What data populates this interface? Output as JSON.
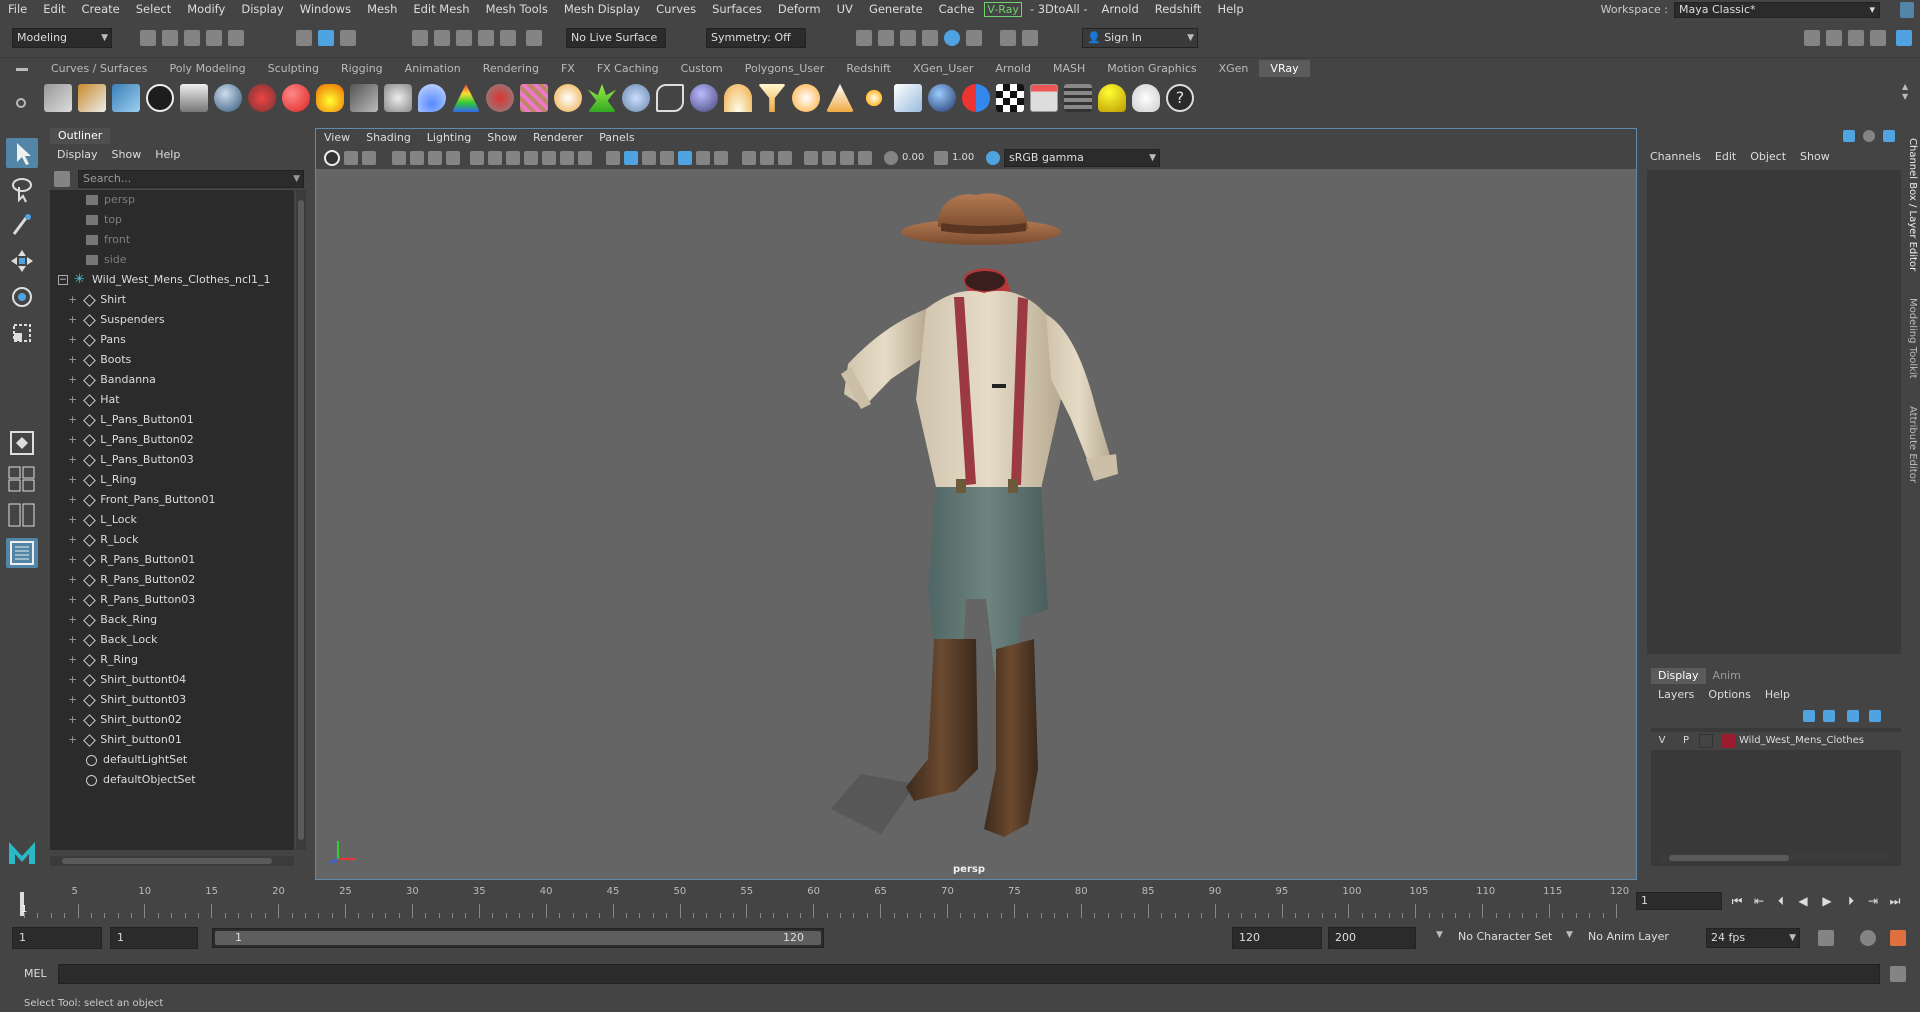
{
  "menubar": {
    "items": [
      "File",
      "Edit",
      "Create",
      "Select",
      "Modify",
      "Display",
      "Windows",
      "Mesh",
      "Edit Mesh",
      "Mesh Tools",
      "Mesh Display",
      "Curves",
      "Surfaces",
      "Deform",
      "UV",
      "Generate",
      "Cache"
    ],
    "vray": "V-Ray",
    "extra": [
      "- 3DtoAll -",
      "Arnold",
      "Redshift",
      "Help"
    ],
    "workspace_label": "Workspace :",
    "workspace_value": "Maya Classic*"
  },
  "statusline": {
    "menu_set": "Modeling",
    "live_surface": "No Live Surface",
    "symmetry": "Symmetry: Off",
    "sign_in": "Sign In"
  },
  "shelf": {
    "tabs": [
      "Curves / Surfaces",
      "Poly Modeling",
      "Sculpting",
      "Rigging",
      "Animation",
      "Rendering",
      "FX",
      "FX Caching",
      "Custom",
      "Polygons_User",
      "Redshift",
      "XGen_User",
      "Arnold",
      "MASH",
      "Motion Graphics",
      "XGen",
      "VRay"
    ],
    "active_tab": "VRay"
  },
  "outliner": {
    "title": "Outliner",
    "menu": [
      "Display",
      "Show",
      "Help"
    ],
    "search_placeholder": "Search...",
    "cameras": [
      "persp",
      "top",
      "front",
      "side"
    ],
    "group": "Wild_West_Mens_Clothes_ncl1_1",
    "children": [
      "Shirt",
      "Suspenders",
      "Pans",
      "Boots",
      "Bandanna",
      "Hat",
      "L_Pans_Button01",
      "L_Pans_Button02",
      "L_Pans_Button03",
      "L_Ring",
      "Front_Pans_Button01",
      "L_Lock",
      "R_Lock",
      "R_Pans_Button01",
      "R_Pans_Button02",
      "R_Pans_Button03",
      "Back_Ring",
      "Back_Lock",
      "R_Ring",
      "Shirt_buttont04",
      "Shirt_buttont03",
      "Shirt_button02",
      "Shirt_button01"
    ],
    "sets": [
      "defaultLightSet",
      "defaultObjectSet"
    ]
  },
  "viewport": {
    "menu": [
      "View",
      "Shading",
      "Lighting",
      "Show",
      "Renderer",
      "Panels"
    ],
    "exposure": "0.00",
    "gamma": "1.00",
    "color_space": "sRGB gamma",
    "camera_label": "persp"
  },
  "channelbox": {
    "menu": [
      "Channels",
      "Edit",
      "Object",
      "Show"
    ],
    "layer_tabs": [
      "Display",
      "Anim"
    ],
    "layer_menu": [
      "Layers",
      "Options",
      "Help"
    ],
    "layer": {
      "v": "V",
      "p": "P",
      "name": "Wild_West_Mens_Clothes",
      "color": "#9a1c2e"
    },
    "side_tabs": [
      "Channel Box / Layer Editor",
      "Modeling Toolkit",
      "Attribute Editor"
    ]
  },
  "timeslider": {
    "labels": [
      "5",
      "10",
      "15",
      "20",
      "25",
      "30",
      "35",
      "40",
      "45",
      "50",
      "55",
      "60",
      "65",
      "70",
      "75",
      "80",
      "85",
      "90",
      "95",
      "100",
      "105",
      "110",
      "115",
      "120"
    ],
    "start_marker": "1",
    "current_frame": "1"
  },
  "range": {
    "start": "1",
    "playback_start": "1",
    "bar_start": "1",
    "bar_end": "120",
    "playback_end": "120",
    "end": "200",
    "character_set": "No Character Set",
    "anim_layer": "No Anim Layer",
    "fps": "24 fps"
  },
  "cmdline": {
    "label": "MEL"
  },
  "helpline": {
    "text": "Select Tool: select an object"
  }
}
